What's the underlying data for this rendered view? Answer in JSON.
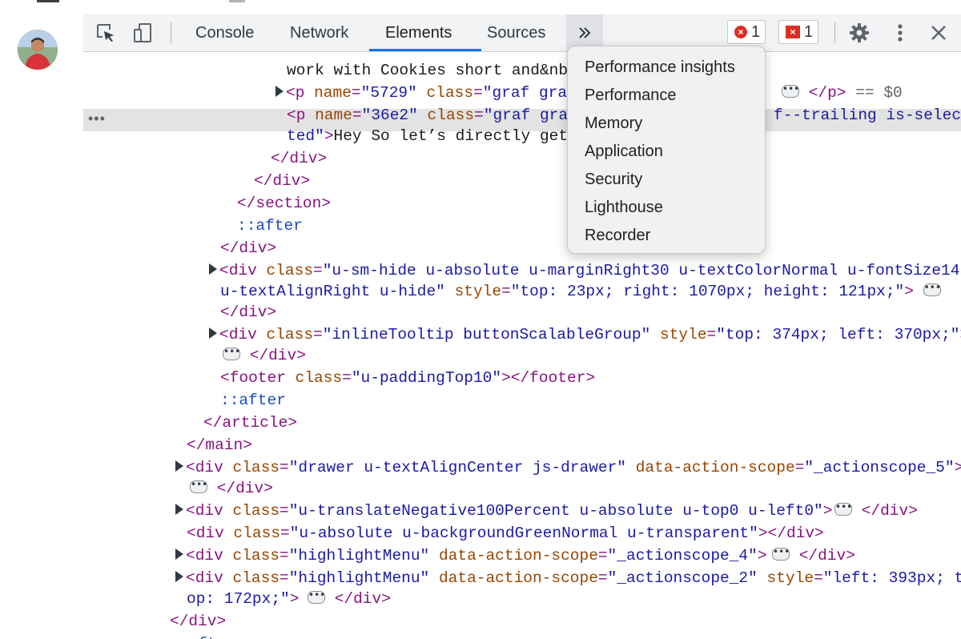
{
  "devtools": {
    "tabs": [
      {
        "label": "Console"
      },
      {
        "label": "Network"
      },
      {
        "label": "Elements"
      },
      {
        "label": "Sources"
      }
    ],
    "active_tab": "Elements",
    "overflow_icon": "double-chevron-right-icon",
    "errors_count": "1",
    "issues_count": "1",
    "row_ellipsis": "•••",
    "selected_suffix": "== $0"
  },
  "overflow_menu": {
    "items": [
      {
        "label": "Performance insights"
      },
      {
        "label": "Performance"
      },
      {
        "label": "Memory"
      },
      {
        "label": "Application"
      },
      {
        "label": "Security"
      },
      {
        "label": "Lighthouse"
      },
      {
        "label": "Recorder"
      }
    ]
  },
  "dom_tree": {
    "lines": [
      {
        "segs": [
          {
            "c": "txt",
            "t": "work with Cookies short and&nb"
          }
        ]
      },
      {
        "segs": [
          {
            "c": "tag",
            "t": "<p "
          },
          {
            "c": "attr",
            "t": "name"
          },
          {
            "c": "tag",
            "t": "="
          },
          {
            "c": "val",
            "t": "\"5729\""
          },
          {
            "c": "tag",
            "t": " "
          },
          {
            "c": "attr",
            "t": "class"
          },
          {
            "c": "tag",
            "t": "="
          },
          {
            "c": "val",
            "t": "\"graf gra"
          }
        ],
        "tail": [
          {
            "c": "tag",
            "t": "</p>"
          }
        ]
      },
      {
        "segs": [
          {
            "c": "tag",
            "t": "<p "
          },
          {
            "c": "attr",
            "t": "name"
          },
          {
            "c": "tag",
            "t": "="
          },
          {
            "c": "val",
            "t": "\"36e2\""
          },
          {
            "c": "tag",
            "t": " "
          },
          {
            "c": "attr",
            "t": "class"
          },
          {
            "c": "tag",
            "t": "="
          },
          {
            "c": "val",
            "t": "\"graf gra"
          }
        ],
        "tail": [
          {
            "c": "val",
            "t": "f--trailing is-selec"
          }
        ]
      },
      {
        "segs": [
          {
            "c": "val",
            "t": "ted\""
          },
          {
            "c": "tag",
            "t": ">"
          },
          {
            "c": "txt",
            "t": "Hey So let’s directly get"
          }
        ]
      },
      {
        "segs": [
          {
            "c": "tag",
            "t": "</div>"
          }
        ]
      },
      {
        "segs": [
          {
            "c": "tag",
            "t": "</div>"
          }
        ]
      },
      {
        "segs": [
          {
            "c": "tag",
            "t": "</section>"
          }
        ]
      },
      {
        "segs": [
          {
            "c": "pseudo",
            "t": "::after"
          }
        ]
      },
      {
        "segs": [
          {
            "c": "tag",
            "t": "</div>"
          }
        ]
      },
      {
        "segs": [
          {
            "c": "tag",
            "t": "<div "
          },
          {
            "c": "attr",
            "t": "class"
          },
          {
            "c": "tag",
            "t": "="
          },
          {
            "c": "val",
            "t": "\"u-sm-hide u-absolute u-marginRight30 u-textColorNormal u-fontSize14"
          }
        ]
      },
      {
        "segs": [
          {
            "c": "val",
            "t": "u-textAlignRight u-hide\""
          },
          {
            "c": "tag",
            "t": " "
          },
          {
            "c": "attr",
            "t": "style"
          },
          {
            "c": "tag",
            "t": "="
          },
          {
            "c": "val",
            "t": "\"top: 23px; right: 1070px; height: 121px;\""
          },
          {
            "c": "tag",
            "t": ">"
          }
        ]
      },
      {
        "segs": [
          {
            "c": "tag",
            "t": "</div>"
          }
        ]
      },
      {
        "segs": [
          {
            "c": "tag",
            "t": "<div "
          },
          {
            "c": "attr",
            "t": "class"
          },
          {
            "c": "tag",
            "t": "="
          },
          {
            "c": "val",
            "t": "\"inlineTooltip buttonScalableGroup\""
          },
          {
            "c": "tag",
            "t": " "
          },
          {
            "c": "attr",
            "t": "style"
          },
          {
            "c": "tag",
            "t": "="
          },
          {
            "c": "val",
            "t": "\"top: 374px; left: 370px;\""
          },
          {
            "c": "tag",
            "t": ">"
          }
        ]
      },
      {
        "segs": [
          {
            "c": "tag",
            "t": "</div>"
          }
        ]
      },
      {
        "segs": [
          {
            "c": "tag",
            "t": "<footer "
          },
          {
            "c": "attr",
            "t": "class"
          },
          {
            "c": "tag",
            "t": "="
          },
          {
            "c": "val",
            "t": "\"u-paddingTop10\""
          },
          {
            "c": "tag",
            "t": "></footer>"
          }
        ]
      },
      {
        "segs": [
          {
            "c": "pseudo",
            "t": "::after"
          }
        ]
      },
      {
        "segs": [
          {
            "c": "tag",
            "t": "</article>"
          }
        ]
      },
      {
        "segs": [
          {
            "c": "tag",
            "t": "</main>"
          }
        ]
      },
      {
        "segs": [
          {
            "c": "tag",
            "t": "<div "
          },
          {
            "c": "attr",
            "t": "class"
          },
          {
            "c": "tag",
            "t": "="
          },
          {
            "c": "val",
            "t": "\"drawer u-textAlignCenter js-drawer\""
          },
          {
            "c": "tag",
            "t": " "
          },
          {
            "c": "attr",
            "t": "data-action-scope"
          },
          {
            "c": "tag",
            "t": "="
          },
          {
            "c": "val",
            "t": "\"_actionscope_5\""
          },
          {
            "c": "tag",
            "t": ">"
          }
        ]
      },
      {
        "segs": [
          {
            "c": "tag",
            "t": "</div>"
          }
        ]
      },
      {
        "segs": [
          {
            "c": "tag",
            "t": "<div "
          },
          {
            "c": "attr",
            "t": "class"
          },
          {
            "c": "tag",
            "t": "="
          },
          {
            "c": "val",
            "t": "\"u-translateNegative100Percent u-absolute u-top0 u-left0\""
          },
          {
            "c": "tag",
            "t": ">"
          }
        ],
        "tail": [
          {
            "c": "tag",
            "t": "</div>"
          }
        ]
      },
      {
        "segs": [
          {
            "c": "tag",
            "t": "<div "
          },
          {
            "c": "attr",
            "t": "class"
          },
          {
            "c": "tag",
            "t": "="
          },
          {
            "c": "val",
            "t": "\"u-absolute u-backgroundGreenNormal u-transparent\""
          },
          {
            "c": "tag",
            "t": "></div>"
          }
        ]
      },
      {
        "segs": [
          {
            "c": "tag",
            "t": "<div "
          },
          {
            "c": "attr",
            "t": "class"
          },
          {
            "c": "tag",
            "t": "="
          },
          {
            "c": "val",
            "t": "\"highlightMenu\""
          },
          {
            "c": "tag",
            "t": " "
          },
          {
            "c": "attr",
            "t": "data-action-scope"
          },
          {
            "c": "tag",
            "t": "="
          },
          {
            "c": "val",
            "t": "\"_actionscope_4\""
          },
          {
            "c": "tag",
            "t": ">"
          }
        ],
        "tail": [
          {
            "c": "tag",
            "t": "</div>"
          }
        ]
      },
      {
        "segs": [
          {
            "c": "tag",
            "t": "<div "
          },
          {
            "c": "attr",
            "t": "class"
          },
          {
            "c": "tag",
            "t": "="
          },
          {
            "c": "val",
            "t": "\"highlightMenu\""
          },
          {
            "c": "tag",
            "t": " "
          },
          {
            "c": "attr",
            "t": "data-action-scope"
          },
          {
            "c": "tag",
            "t": "="
          },
          {
            "c": "val",
            "t": "\"_actionscope_2\""
          },
          {
            "c": "tag",
            "t": " "
          },
          {
            "c": "attr",
            "t": "style"
          },
          {
            "c": "tag",
            "t": "="
          },
          {
            "c": "val",
            "t": "\"left: 393px; t"
          }
        ]
      },
      {
        "segs": [
          {
            "c": "val",
            "t": "op: 172px;\""
          },
          {
            "c": "tag",
            "t": ">"
          }
        ],
        "tail": [
          {
            "c": "tag",
            "t": "</div>"
          }
        ]
      },
      {
        "segs": [
          {
            "c": "tag",
            "t": "</div>"
          }
        ]
      },
      {
        "segs": [
          {
            "c": "pseudo",
            "t": "::after"
          }
        ]
      }
    ]
  }
}
